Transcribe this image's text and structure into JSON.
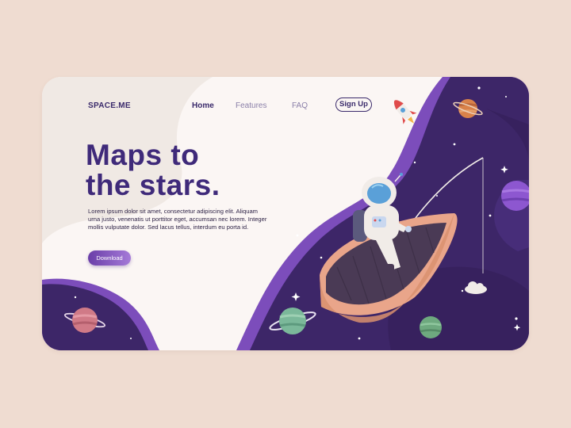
{
  "brand": {
    "logo_text": "SPACE.ME"
  },
  "nav": {
    "items": [
      {
        "label": "Home",
        "active": true
      },
      {
        "label": "Features",
        "active": false
      },
      {
        "label": "FAQ",
        "active": false
      }
    ],
    "signup_label": "Sign Up"
  },
  "hero": {
    "title_line1": "Maps to",
    "title_line2": "the stars.",
    "body": "Lorem ipsum dolor sit amet, consectetur adipiscing elit. Aliquam urna justo, venenatis ut porttitor eget, accumsan nec lorem. Integer mollis vulputate dolor. Sed lacus tellus, interdum eu porta id.",
    "cta_label": "Download"
  },
  "colors": {
    "page_bg": "#efdcd1",
    "card_bg": "#fbf6f4",
    "space_dark": "#3d2668",
    "space_mid": "#5b3a9a",
    "accent_purple": "#7c4dbb",
    "text_dark": "#3a2a6b"
  },
  "illustration": {
    "icons": [
      "rocket-icon",
      "planet-icon",
      "astronaut",
      "boat",
      "moon-icon",
      "cloud-icon",
      "stars"
    ]
  }
}
